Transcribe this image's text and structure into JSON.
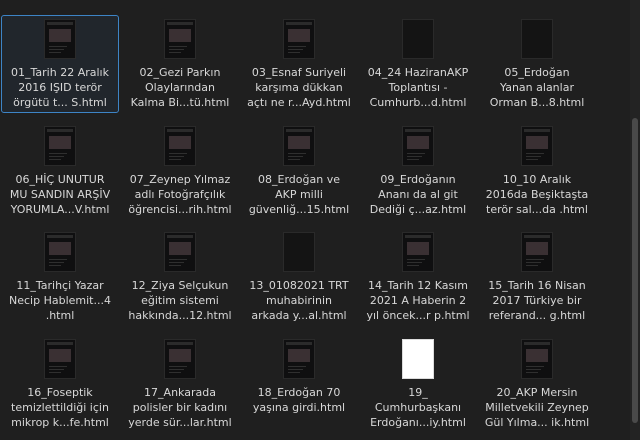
{
  "files": [
    {
      "label": "01_Tarih 22 Aralık\n2016 IŞID terör\nörgütü t... S.html",
      "selected": true,
      "thumb": "dark"
    },
    {
      "label": "02_Gezi Parkın\nOlaylarından\nKalma Bi...tü.html",
      "selected": false,
      "thumb": "dark"
    },
    {
      "label": "03_Esnaf Suriyeli\nkarşıma dükkan\naçtı ne r...Ayd.html",
      "selected": false,
      "thumb": "dark"
    },
    {
      "label": "04_24 HaziranAKP\nToplantısı -\nCumhurb...d.html",
      "selected": false,
      "thumb": "plain"
    },
    {
      "label": "05_Erdoğan\nYanan alanlar\nOrman B...8.html",
      "selected": false,
      "thumb": "plain"
    },
    {
      "label": "06_HİÇ UNUTUR\nMU SANDIN ARŞİV\nYORUMLA...V.html",
      "selected": false,
      "thumb": "dark"
    },
    {
      "label": "07_Zeynep Yılmaz\nadlı Fotoğrafçılık\nöğrencisi...rih.html",
      "selected": false,
      "thumb": "dark"
    },
    {
      "label": "08_Erdoğan ve\nAKP milli\ngüvenliğ...15.html",
      "selected": false,
      "thumb": "dark"
    },
    {
      "label": "09_Erdoğanın\nAnanı da al git\nDediği ç...az.html",
      "selected": false,
      "thumb": "dark"
    },
    {
      "label": "10_10 Aralık\n2016da Beşiktaşta\nterör sal...da .html",
      "selected": false,
      "thumb": "dark"
    },
    {
      "label": "11_Tarihçi Yazar\nNecip Hablemit...4\n.html",
      "selected": false,
      "thumb": "dark"
    },
    {
      "label": "12_Ziya Selçukun\neğitim sistemi\nhakkında...12.html",
      "selected": false,
      "thumb": "dark"
    },
    {
      "label": "13_01082021 TRT\nmuhabirinin\narkada y...al.html",
      "selected": false,
      "thumb": "plain"
    },
    {
      "label": "14_Tarih 12 Kasım\n2021 A Haberin 2\nyıl öncek...r p.html",
      "selected": false,
      "thumb": "dark"
    },
    {
      "label": "15_Tarih 16 Nisan\n2017 Türkiye bir\nreferand... g.html",
      "selected": false,
      "thumb": "dark"
    },
    {
      "label": "16_Foseptik\ntemizlettildiği için\nmikrop k...fe.html",
      "selected": false,
      "thumb": "dark"
    },
    {
      "label": "17_Ankarada\npolisler bir kadını\nyerde sür...lar.html",
      "selected": false,
      "thumb": "dark"
    },
    {
      "label": "18_Erdoğan 70\nyaşına girdi.html",
      "selected": false,
      "thumb": "dark"
    },
    {
      "label": "19_\nCumhurbaşkanı\nErdoğanı...iy.html",
      "selected": false,
      "thumb": "white"
    },
    {
      "label": "20_AKP Mersin\nMilletvekili Zeynep\nGül Yılma... ik.html",
      "selected": false,
      "thumb": "dark"
    }
  ]
}
